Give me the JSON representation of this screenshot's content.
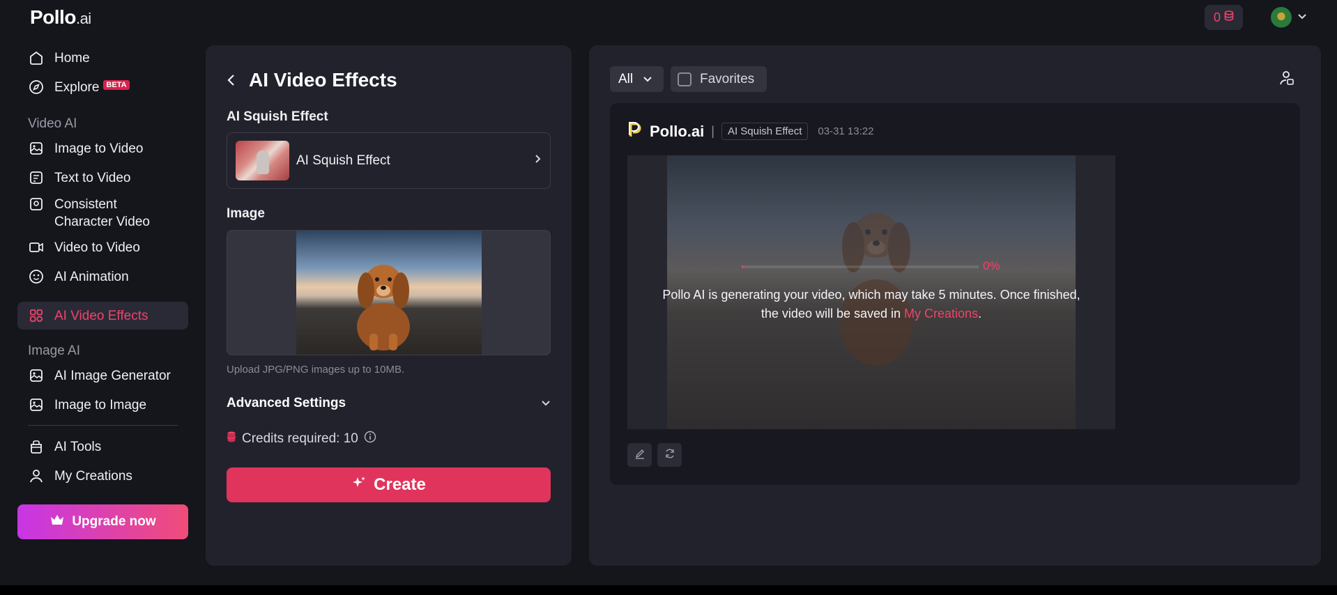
{
  "app": {
    "logo_main": "Pollo",
    "logo_suffix": ".ai",
    "credit_count": "0"
  },
  "sidebar": {
    "home": "Home",
    "explore": "Explore",
    "explore_badge": "BETA",
    "section_video": "Video AI",
    "image_to_video": "Image to Video",
    "text_to_video": "Text to Video",
    "consistent_line1": "Consistent",
    "consistent_line2": "Character Video",
    "video_to_video": "Video to Video",
    "ai_animation": "AI Animation",
    "ai_video_effects": "AI Video Effects",
    "section_image": "Image AI",
    "ai_image_generator": "AI Image Generator",
    "image_to_image": "Image to Image",
    "ai_tools": "AI Tools",
    "my_creations": "My Creations",
    "upgrade": "Upgrade now"
  },
  "form": {
    "title": "AI Video Effects",
    "effect_label": "AI Squish Effect",
    "effect_value": "AI Squish Effect",
    "image_label": "Image",
    "upload_hint": "Upload JPG/PNG images up to 10MB.",
    "advanced": "Advanced Settings",
    "credits_text": "Credits required: 10",
    "create": "Create"
  },
  "results": {
    "filter_all": "All",
    "favorites": "Favorites",
    "card": {
      "brand": "Pollo.ai",
      "separator": "|",
      "tag": "AI Squish Effect",
      "timestamp": "03-31 13:22",
      "progress_percent": 0,
      "progress_label": "0%",
      "message_part1": "Pollo AI is generating your video, which may take 5 minutes. Once finished, the video will be saved in ",
      "message_link": "My Creations",
      "message_end": "."
    }
  },
  "colors": {
    "accent": "#f0436b",
    "panel": "#22222c",
    "background": "#15151c"
  }
}
